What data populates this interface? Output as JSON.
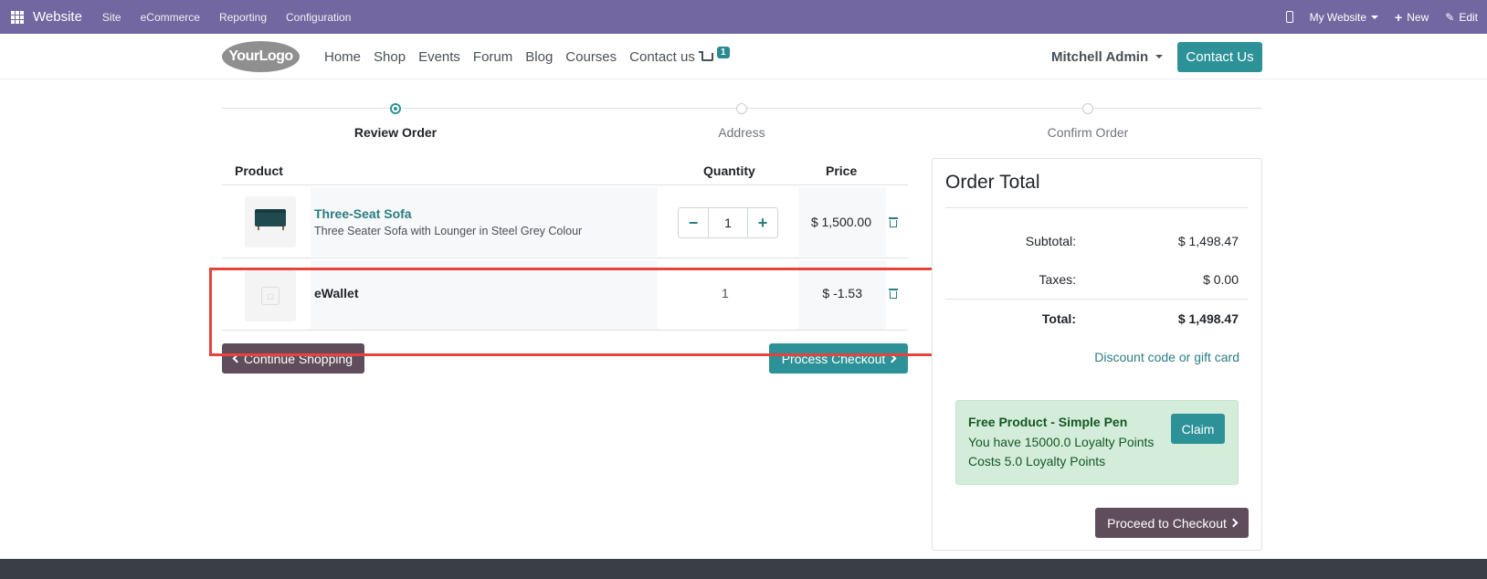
{
  "adminbar": {
    "brand": "Website",
    "menu": [
      "Site",
      "eCommerce",
      "Reporting",
      "Configuration"
    ],
    "my_website": "My Website",
    "new": "New",
    "edit": "Edit"
  },
  "header": {
    "logo_text": "YourLogo",
    "nav": [
      "Home",
      "Shop",
      "Events",
      "Forum",
      "Blog",
      "Courses",
      "Contact us"
    ],
    "cart_count": "1",
    "user": "Mitchell Admin",
    "contact_button": "Contact Us"
  },
  "steps": {
    "items": [
      "Review Order",
      "Address",
      "Confirm Order"
    ],
    "active_index": 0
  },
  "cart": {
    "headers": {
      "product": "Product",
      "quantity": "Quantity",
      "price": "Price"
    },
    "rows": [
      {
        "name": "Three-Seat Sofa",
        "description": "Three Seater Sofa with Lounger in Steel Grey Colour",
        "quantity": "1",
        "price": "$ 1,500.00"
      },
      {
        "name": "eWallet",
        "description": "",
        "quantity": "1",
        "price": "$ -1.53"
      }
    ],
    "continue_label": "Continue Shopping",
    "process_label": "Process Checkout"
  },
  "order_total": {
    "title": "Order Total",
    "subtotal_label": "Subtotal:",
    "subtotal": "$ 1,498.47",
    "taxes_label": "Taxes:",
    "taxes": "$ 0.00",
    "total_label": "Total:",
    "total": "$ 1,498.47",
    "discount_link": "Discount code or gift card",
    "reward": {
      "title": "Free Product - Simple Pen",
      "points": "You have 15000.0 Loyalty Points",
      "cost": "Costs 5.0 Loyalty Points",
      "claim": "Claim"
    },
    "proceed_label": "Proceed to Checkout"
  },
  "colors": {
    "admin_bar": "#7267a0",
    "primary": "#2d9298",
    "secondary": "#5f4d5c",
    "highlight": "#e8423a"
  }
}
